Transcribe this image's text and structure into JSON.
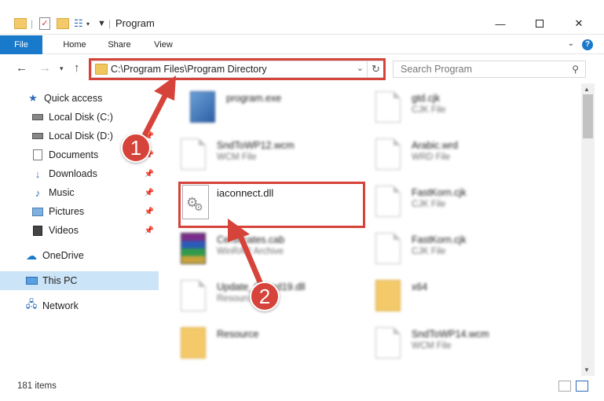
{
  "window": {
    "title": "Program"
  },
  "ribbon": {
    "tabs": [
      "File",
      "Home",
      "Share",
      "View"
    ],
    "help": "?"
  },
  "address": {
    "path": "C:\\Program Files\\Program Directory"
  },
  "search": {
    "placeholder": "Search Program"
  },
  "sidebar": {
    "items": [
      {
        "label": "Quick access",
        "icon": "star-icon"
      },
      {
        "label": "Local Disk (C:)",
        "icon": "drive-icon"
      },
      {
        "label": "Local Disk (D:)",
        "icon": "drive-icon"
      },
      {
        "label": "Documents",
        "icon": "documents-icon"
      },
      {
        "label": "Downloads",
        "icon": "download-icon"
      },
      {
        "label": "Music",
        "icon": "music-icon"
      },
      {
        "label": "Pictures",
        "icon": "pictures-icon"
      },
      {
        "label": "Videos",
        "icon": "videos-icon"
      },
      {
        "label": "OneDrive",
        "icon": "cloud-icon"
      },
      {
        "label": "This PC",
        "icon": "computer-icon"
      },
      {
        "label": "Network",
        "icon": "network-icon"
      }
    ]
  },
  "files": {
    "left": [
      {
        "name": "program.exe",
        "type": ""
      },
      {
        "name": "SndToWP12.wcm",
        "type": "WCM File"
      },
      {
        "name": "Certificates.cab",
        "type": "WinRAR Archive"
      },
      {
        "name": "Update_Sched19.dll",
        "type": "Resource"
      },
      {
        "name": "Resource",
        "type": ""
      }
    ],
    "right": [
      {
        "name": "gtd.cjk",
        "type": "CJK File"
      },
      {
        "name": "Arabic.wrd",
        "type": "WRD File"
      },
      {
        "name": "FastKorn.cjk",
        "type": "CJK File"
      },
      {
        "name": "FastKorn.cjk",
        "type": "CJK File"
      },
      {
        "name": "x64",
        "type": ""
      },
      {
        "name": "SndToWP14.wcm",
        "type": "WCM File"
      }
    ]
  },
  "target_file": {
    "name": "iaconnect.dll"
  },
  "status": {
    "count": "181 items"
  },
  "callouts": {
    "one": "1",
    "two": "2"
  },
  "colors": {
    "accent": "#1979ca",
    "highlight": "#d6433a",
    "selected": "#cce4f7"
  }
}
